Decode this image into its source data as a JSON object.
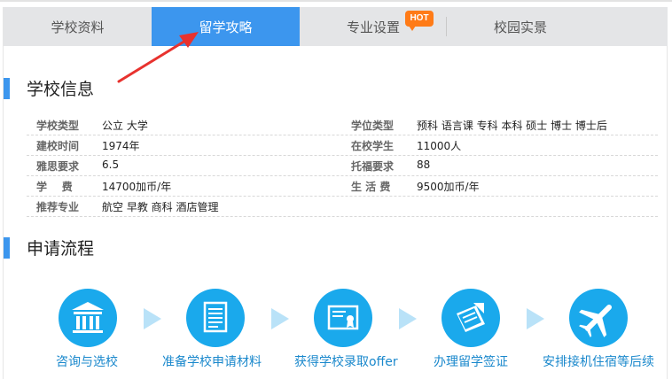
{
  "tabs": [
    {
      "label": "学校资料",
      "active": false
    },
    {
      "label": "留学攻略",
      "active": true
    },
    {
      "label": "专业设置",
      "active": false,
      "badge": "HOT"
    },
    {
      "label": "校园实景",
      "active": false
    }
  ],
  "school_info": {
    "title": "学校信息",
    "rows": [
      [
        {
          "label": "学校类型",
          "value": "公立  大学"
        },
        {
          "label": "学位类型",
          "value": "预科 语言课 专科 本科 硕士 博士 博士后"
        }
      ],
      [
        {
          "label": "建校时间",
          "value": "1974年"
        },
        {
          "label": "在校学生",
          "value": "11000人"
        }
      ],
      [
        {
          "label": "雅思要求",
          "value": "6.5"
        },
        {
          "label": "托福要求",
          "value": "88"
        }
      ],
      [
        {
          "label": "学    费",
          "value": "14700加币/年"
        },
        {
          "label": "生 活 费",
          "value": "9500加币/年"
        }
      ],
      [
        {
          "label": "推荐专业",
          "value": "航空 早教 商科 酒店管理"
        }
      ]
    ]
  },
  "process": {
    "title": "申请流程",
    "steps": [
      {
        "label": "咨询与选校",
        "icon": "school-building-icon"
      },
      {
        "label": "准备学校申请材料",
        "icon": "document-icon"
      },
      {
        "label": "获得学校录取offer",
        "icon": "certificate-icon"
      },
      {
        "label": "办理留学签证",
        "icon": "passport-icon"
      },
      {
        "label": "安排接机住宿等后续",
        "icon": "airplane-icon"
      }
    ]
  },
  "colors": {
    "accent": "#3c96ee",
    "step_circle": "#1aa9ec",
    "hot_badge": "#ff7b17",
    "annotation_arrow": "#e8322e"
  }
}
